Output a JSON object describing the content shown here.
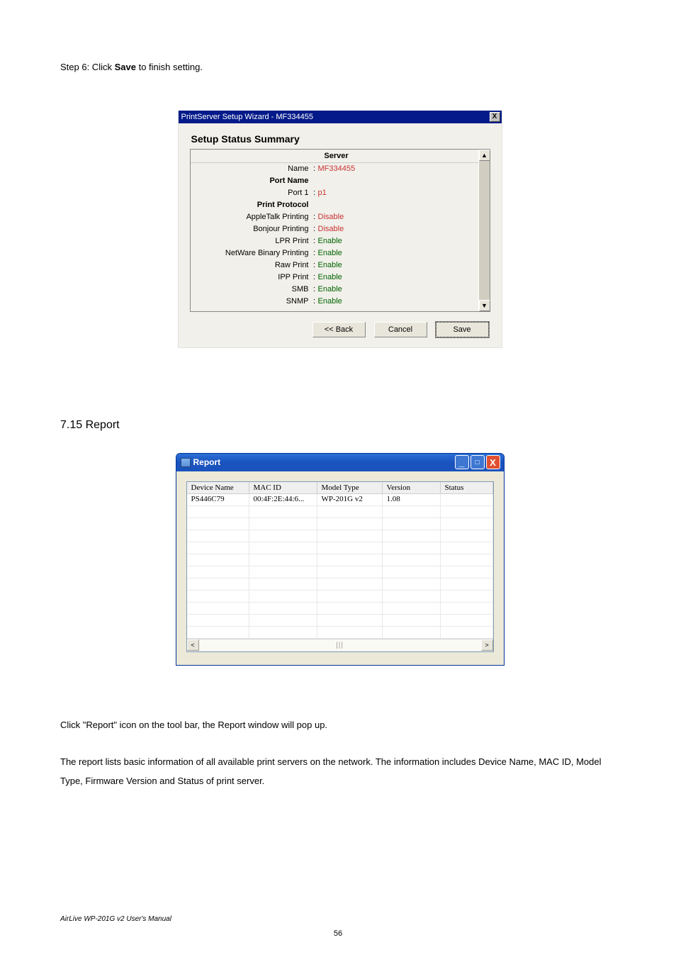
{
  "intro": {
    "prefix": "Step 6: Click ",
    "bold": "Save",
    "suffix": " to finish setting."
  },
  "wizard": {
    "title": "PrintServer Setup Wizard - MF334455",
    "close_x": "X",
    "heading": "Setup Status Summary",
    "server_header": "Server",
    "name_label": "Name",
    "name_value": "MF334455",
    "portname_header": "Port Name",
    "port1_label": "Port 1",
    "port1_value": "p1",
    "protocol_header": "Print Protocol",
    "rows": {
      "appletalk_l": "AppleTalk Printing",
      "appletalk_v": "Disable",
      "bonjour_l": "Bonjour Printing",
      "bonjour_v": "Disable",
      "lpr_l": "LPR Print",
      "lpr_v": "Enable",
      "netware_l": "NetWare Binary Printing",
      "netware_v": "Enable",
      "raw_l": "Raw Print",
      "raw_v": "Enable",
      "ipp_l": "IPP Print",
      "ipp_v": "Enable",
      "smb_l": "SMB",
      "smb_v": "Enable",
      "snmp_l": "SNMP",
      "snmp_v": "Enable"
    },
    "buttons": {
      "back": "<< Back",
      "cancel": "Cancel",
      "save": "Save"
    },
    "scroll_up": "▲",
    "scroll_down": "▼"
  },
  "section_heading": "7.15 Report",
  "report": {
    "title": "Report",
    "minimize": "_",
    "maximize": "□",
    "close": "X",
    "headers": {
      "c1": "Device Name",
      "c2": "MAC ID",
      "c3": "Model Type",
      "c4": "Version",
      "c5": "Status"
    },
    "row1": {
      "c1": "PS446C79",
      "c2": "00:4F:2E:44:6...",
      "c3": "WP-201G v2",
      "c4": "1.08",
      "c5": ""
    },
    "scroll_left": "<",
    "scroll_right": ">",
    "nub": "|||"
  },
  "para1": "Click \"Report\" icon on the tool bar, the Report window will pop up.",
  "para2": "The report lists basic information of all available print servers on the network. The information includes Device Name, MAC ID, Model Type, Firmware Version and Status of print server.",
  "footer_note": "AirLive WP-201G v2 User's Manual",
  "page_number": "56",
  "colon": ":"
}
